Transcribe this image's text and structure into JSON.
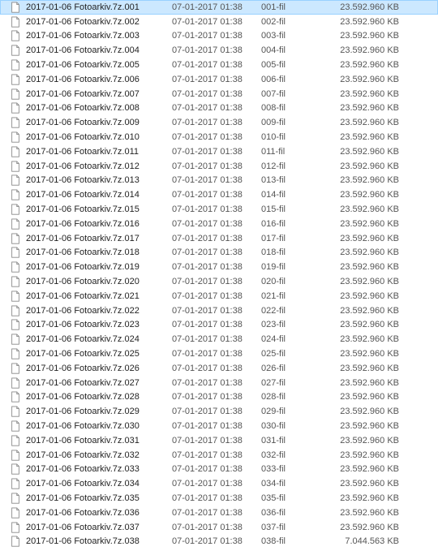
{
  "files": [
    {
      "name": "2017-01-06 Fotoarkiv.7z.001",
      "date": "07-01-2017 01:38",
      "type": "001-fil",
      "size": "23.592.960 KB",
      "selected": true
    },
    {
      "name": "2017-01-06 Fotoarkiv.7z.002",
      "date": "07-01-2017 01:38",
      "type": "002-fil",
      "size": "23.592.960 KB",
      "selected": false
    },
    {
      "name": "2017-01-06 Fotoarkiv.7z.003",
      "date": "07-01-2017 01:38",
      "type": "003-fil",
      "size": "23.592.960 KB",
      "selected": false
    },
    {
      "name": "2017-01-06 Fotoarkiv.7z.004",
      "date": "07-01-2017 01:38",
      "type": "004-fil",
      "size": "23.592.960 KB",
      "selected": false
    },
    {
      "name": "2017-01-06 Fotoarkiv.7z.005",
      "date": "07-01-2017 01:38",
      "type": "005-fil",
      "size": "23.592.960 KB",
      "selected": false
    },
    {
      "name": "2017-01-06 Fotoarkiv.7z.006",
      "date": "07-01-2017 01:38",
      "type": "006-fil",
      "size": "23.592.960 KB",
      "selected": false
    },
    {
      "name": "2017-01-06 Fotoarkiv.7z.007",
      "date": "07-01-2017 01:38",
      "type": "007-fil",
      "size": "23.592.960 KB",
      "selected": false
    },
    {
      "name": "2017-01-06 Fotoarkiv.7z.008",
      "date": "07-01-2017 01:38",
      "type": "008-fil",
      "size": "23.592.960 KB",
      "selected": false
    },
    {
      "name": "2017-01-06 Fotoarkiv.7z.009",
      "date": "07-01-2017 01:38",
      "type": "009-fil",
      "size": "23.592.960 KB",
      "selected": false
    },
    {
      "name": "2017-01-06 Fotoarkiv.7z.010",
      "date": "07-01-2017 01:38",
      "type": "010-fil",
      "size": "23.592.960 KB",
      "selected": false
    },
    {
      "name": "2017-01-06 Fotoarkiv.7z.011",
      "date": "07-01-2017 01:38",
      "type": "011-fil",
      "size": "23.592.960 KB",
      "selected": false
    },
    {
      "name": "2017-01-06 Fotoarkiv.7z.012",
      "date": "07-01-2017 01:38",
      "type": "012-fil",
      "size": "23.592.960 KB",
      "selected": false
    },
    {
      "name": "2017-01-06 Fotoarkiv.7z.013",
      "date": "07-01-2017 01:38",
      "type": "013-fil",
      "size": "23.592.960 KB",
      "selected": false
    },
    {
      "name": "2017-01-06 Fotoarkiv.7z.014",
      "date": "07-01-2017 01:38",
      "type": "014-fil",
      "size": "23.592.960 KB",
      "selected": false
    },
    {
      "name": "2017-01-06 Fotoarkiv.7z.015",
      "date": "07-01-2017 01:38",
      "type": "015-fil",
      "size": "23.592.960 KB",
      "selected": false
    },
    {
      "name": "2017-01-06 Fotoarkiv.7z.016",
      "date": "07-01-2017 01:38",
      "type": "016-fil",
      "size": "23.592.960 KB",
      "selected": false
    },
    {
      "name": "2017-01-06 Fotoarkiv.7z.017",
      "date": "07-01-2017 01:38",
      "type": "017-fil",
      "size": "23.592.960 KB",
      "selected": false
    },
    {
      "name": "2017-01-06 Fotoarkiv.7z.018",
      "date": "07-01-2017 01:38",
      "type": "018-fil",
      "size": "23.592.960 KB",
      "selected": false
    },
    {
      "name": "2017-01-06 Fotoarkiv.7z.019",
      "date": "07-01-2017 01:38",
      "type": "019-fil",
      "size": "23.592.960 KB",
      "selected": false
    },
    {
      "name": "2017-01-06 Fotoarkiv.7z.020",
      "date": "07-01-2017 01:38",
      "type": "020-fil",
      "size": "23.592.960 KB",
      "selected": false
    },
    {
      "name": "2017-01-06 Fotoarkiv.7z.021",
      "date": "07-01-2017 01:38",
      "type": "021-fil",
      "size": "23.592.960 KB",
      "selected": false
    },
    {
      "name": "2017-01-06 Fotoarkiv.7z.022",
      "date": "07-01-2017 01:38",
      "type": "022-fil",
      "size": "23.592.960 KB",
      "selected": false
    },
    {
      "name": "2017-01-06 Fotoarkiv.7z.023",
      "date": "07-01-2017 01:38",
      "type": "023-fil",
      "size": "23.592.960 KB",
      "selected": false
    },
    {
      "name": "2017-01-06 Fotoarkiv.7z.024",
      "date": "07-01-2017 01:38",
      "type": "024-fil",
      "size": "23.592.960 KB",
      "selected": false
    },
    {
      "name": "2017-01-06 Fotoarkiv.7z.025",
      "date": "07-01-2017 01:38",
      "type": "025-fil",
      "size": "23.592.960 KB",
      "selected": false
    },
    {
      "name": "2017-01-06 Fotoarkiv.7z.026",
      "date": "07-01-2017 01:38",
      "type": "026-fil",
      "size": "23.592.960 KB",
      "selected": false
    },
    {
      "name": "2017-01-06 Fotoarkiv.7z.027",
      "date": "07-01-2017 01:38",
      "type": "027-fil",
      "size": "23.592.960 KB",
      "selected": false
    },
    {
      "name": "2017-01-06 Fotoarkiv.7z.028",
      "date": "07-01-2017 01:38",
      "type": "028-fil",
      "size": "23.592.960 KB",
      "selected": false
    },
    {
      "name": "2017-01-06 Fotoarkiv.7z.029",
      "date": "07-01-2017 01:38",
      "type": "029-fil",
      "size": "23.592.960 KB",
      "selected": false
    },
    {
      "name": "2017-01-06 Fotoarkiv.7z.030",
      "date": "07-01-2017 01:38",
      "type": "030-fil",
      "size": "23.592.960 KB",
      "selected": false
    },
    {
      "name": "2017-01-06 Fotoarkiv.7z.031",
      "date": "07-01-2017 01:38",
      "type": "031-fil",
      "size": "23.592.960 KB",
      "selected": false
    },
    {
      "name": "2017-01-06 Fotoarkiv.7z.032",
      "date": "07-01-2017 01:38",
      "type": "032-fil",
      "size": "23.592.960 KB",
      "selected": false
    },
    {
      "name": "2017-01-06 Fotoarkiv.7z.033",
      "date": "07-01-2017 01:38",
      "type": "033-fil",
      "size": "23.592.960 KB",
      "selected": false
    },
    {
      "name": "2017-01-06 Fotoarkiv.7z.034",
      "date": "07-01-2017 01:38",
      "type": "034-fil",
      "size": "23.592.960 KB",
      "selected": false
    },
    {
      "name": "2017-01-06 Fotoarkiv.7z.035",
      "date": "07-01-2017 01:38",
      "type": "035-fil",
      "size": "23.592.960 KB",
      "selected": false
    },
    {
      "name": "2017-01-06 Fotoarkiv.7z.036",
      "date": "07-01-2017 01:38",
      "type": "036-fil",
      "size": "23.592.960 KB",
      "selected": false
    },
    {
      "name": "2017-01-06 Fotoarkiv.7z.037",
      "date": "07-01-2017 01:38",
      "type": "037-fil",
      "size": "23.592.960 KB",
      "selected": false
    },
    {
      "name": "2017-01-06 Fotoarkiv.7z.038",
      "date": "07-01-2017 01:38",
      "type": "038-fil",
      "size": "7.044.563 KB",
      "selected": false
    }
  ]
}
